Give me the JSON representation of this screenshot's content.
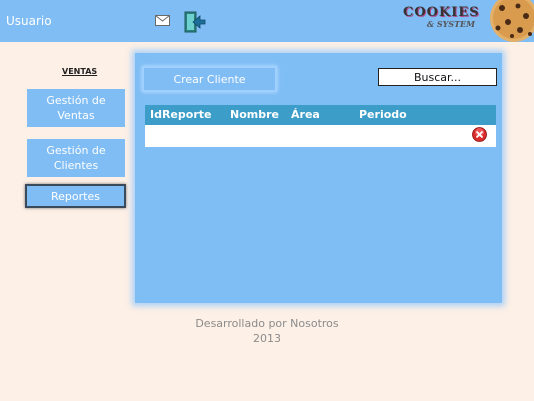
{
  "header": {
    "user_label": "Usuario",
    "logo_main": "COOKIES",
    "logo_sub": "& SYSTEM"
  },
  "sidebar": {
    "section_title": "VENTAS",
    "items": [
      {
        "label": "Gestión de Ventas"
      },
      {
        "label": "Gestión de Clientes"
      },
      {
        "label": "Reportes"
      }
    ]
  },
  "main": {
    "create_label": "Crear Cliente",
    "search_label": "Buscar...",
    "table": {
      "columns": [
        "IdReporte",
        "Nombre",
        "Área",
        "Periodo"
      ]
    }
  },
  "footer": {
    "line1": "Desarrollado por Nosotros",
    "line2": "2013"
  },
  "colors": {
    "accent": "#80bdf5",
    "table_header": "#3b9dc8",
    "background": "#fdf0e6"
  },
  "icons": [
    "mail-icon",
    "exit-icon",
    "delete-icon",
    "cookie-icon"
  ]
}
